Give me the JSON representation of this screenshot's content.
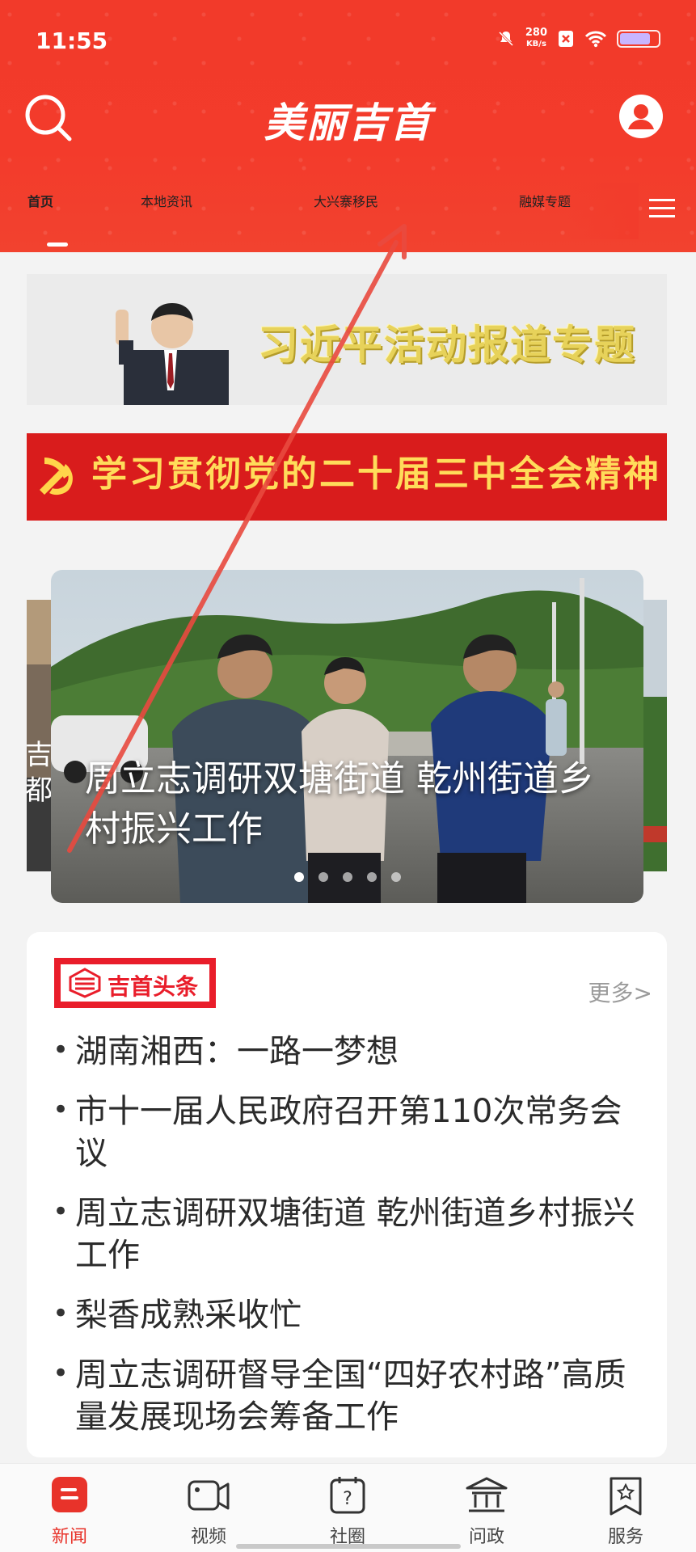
{
  "status_bar": {
    "time": "11:55",
    "network_speed_value": "280",
    "network_speed_unit": "KB/s"
  },
  "header": {
    "app_title": "美丽吉首",
    "tabs": [
      {
        "label": "首页",
        "active": true
      },
      {
        "label": "本地资讯",
        "active": false
      },
      {
        "label": "大兴寨移民",
        "active": false
      },
      {
        "label": "融媒专题",
        "active": false
      }
    ]
  },
  "banners": {
    "banner1_text": "习近平活动报道专题",
    "banner2_text": "学习贯彻党的二十届三中全会精神"
  },
  "carousel": {
    "caption": "周立志调研双塘街道 乾州街道乡村振兴工作",
    "left_peek_text": "吉\n都",
    "dot_count": 5,
    "active_dot": 0
  },
  "news_card": {
    "badge_label": "吉首头条",
    "more_label": "更多>",
    "items": [
      "湖南湘西：一路一梦想",
      "市十一届人民政府召开第110次常务会议",
      "周立志调研双塘街道 乾州街道乡村振兴工作",
      "梨香成熟采收忙",
      "周立志调研督导全国“四好农村路”高质量发展现场会筹备工作"
    ]
  },
  "bottom_nav": {
    "items": [
      {
        "label": "新闻",
        "icon": "news-icon",
        "active": true
      },
      {
        "label": "视频",
        "icon": "video-icon",
        "active": false
      },
      {
        "label": "社圈",
        "icon": "community-icon",
        "active": false
      },
      {
        "label": "问政",
        "icon": "government-icon",
        "active": false
      },
      {
        "label": "服务",
        "icon": "service-icon",
        "active": false
      }
    ]
  },
  "colors": {
    "brand_red": "#f23a2a",
    "active_nav": "#e8332a",
    "headline_red": "#e91d2a"
  }
}
